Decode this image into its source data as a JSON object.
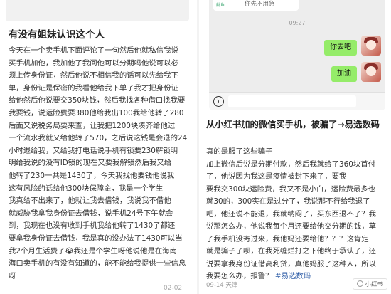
{
  "left_post": {
    "title": "有没有姐妹认识这个人",
    "lines": [
      "今天在一个卖手机下面评论了一句然后他就私信我说",
      "买手机加他，我加他了我问他可以分期吗他说可以必",
      "须上传身份证，然后他说不相信我的话可以先给我下",
      "单，身份证是保密的我看他给我下单了我才把身份证",
      "给他然后他说要交350块钱，然后我找各种借口找我要",
      "我要钱，说运险费要380他给我出100我给他转了280",
      "后面又说税务局要来查，让我把1200块凑齐给他过",
      "一个流水我就又给他转了570，之后说这钱是会退的24",
      "小时退给我，又给我打电话说手机有锁要230解锁明",
      "明给我说的没有ID锁的现在又要我解锁然后我又给",
      "他转了230一共是1430了，今天我找他要钱他说我",
      "这有风险的话给他300块保障金，我是一个学生",
      "我真给不出来了，他就让我去借钱，我说我不借他",
      "就威胁我拿我身份证去借钱，说手机24号下午就会",
      "到，我现在也没有收到手机我给他转了1430了都还",
      "要拿我身份证去借钱，我是真的没办法了1430可以当",
      "我2个月生活费了😭我还是个学生呀他说他是在海南",
      "海口卖手机的有没有知道的，能不能给我提供一些信息",
      "呀"
    ],
    "date": "02-02"
  },
  "chat": {
    "prev_icon_text": "鱿鱼",
    "prev_text": "你先不用急",
    "time": "09:27",
    "messages": [
      "你去吧",
      "加油"
    ]
  },
  "right_post": {
    "title_lines": [
      "从小红书加的微信买手机，被骗了→易选数码"
    ],
    "lines": [
      {
        "text": "真的是服了这些骗子"
      },
      {
        "text": "加上微信后说是分期付款，然后我就给了360块首付"
      },
      {
        "text": "了，他说因为我这是疫情被封下来了，要我"
      },
      {
        "text": "要我交300块运险费，我又不是小白，运险费最多也"
      },
      {
        "text": "就30的，300实在是过分了，我说那不行给我退了"
      },
      {
        "text": "吧，他还说不能退，我就纳闷了，买东西退不了？我"
      },
      {
        "text": "说那怎么办，他说我每个月还要给他交分期的钱，草"
      },
      {
        "text": "了我手机没寄过来，我他妈还要给他？？？这肯定"
      },
      {
        "text": "就是骗子了呗，在我死缠烂打之下他终于承认了，还"
      },
      {
        "text": "说要拿我身份证借高利贷，真他妈服了这种人，所以"
      },
      {
        "text": "我要怎么办，报警？",
        "tag": "#易选数码"
      }
    ],
    "date": "09-14 天津",
    "watermark": "小红书"
  }
}
